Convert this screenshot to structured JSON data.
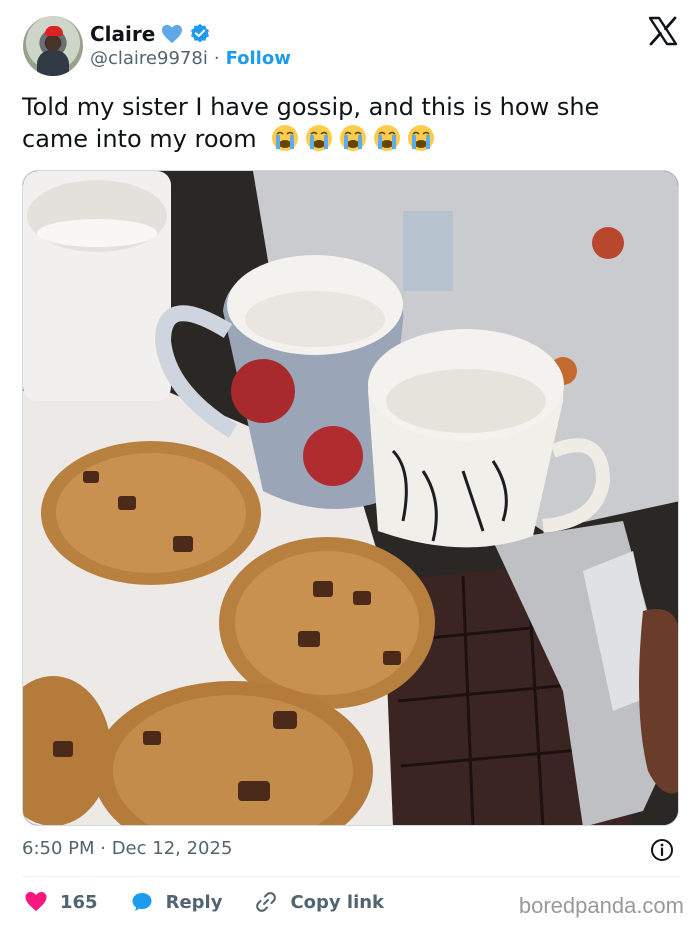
{
  "author": {
    "display_name": "Claire",
    "handle": "@claire9978i",
    "separator": "·",
    "follow_label": "Follow"
  },
  "tweet": {
    "text": "Told my sister I have gossip, and this is how she came into my room",
    "emoji_icons": [
      "loudly-crying-face",
      "loudly-crying-face",
      "loudly-crying-face",
      "loudly-crying-face",
      "loudly-crying-face"
    ],
    "image_subject": "photo-cookies-and-mugs"
  },
  "meta": {
    "timestamp": "6:50 PM · Dec 12, 2025"
  },
  "actions": {
    "like_count": "165",
    "reply_label": "Reply",
    "copy_label": "Copy link"
  },
  "watermark": "boredpanda.com",
  "colors": {
    "accent": "#1d9bf0",
    "like": "#f91880",
    "text": "#0f1419",
    "muted": "#536471"
  }
}
